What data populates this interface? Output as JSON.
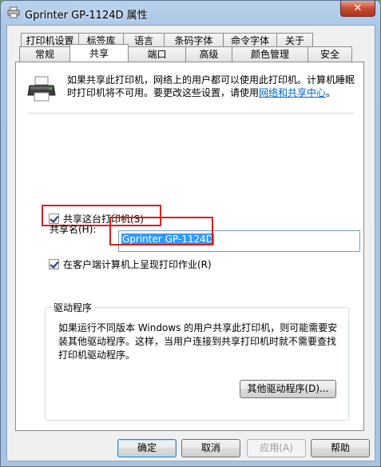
{
  "window": {
    "title": "Gprinter  GP-1124D 属性",
    "close_label": "✕"
  },
  "tabs_back": [
    "打印机设置",
    "标签库",
    "语言",
    "条码字体",
    "命令字体",
    "关于"
  ],
  "tabs_front": [
    "常规",
    "共享",
    "端口",
    "高级",
    "颜色管理",
    "安全"
  ],
  "active_tab": "共享",
  "panel": {
    "info_text": "如果共享此打印机，网络上的用户都可以使用此打印机。计算机睡眠时打印机将不可用。要更改这些设置，请使用",
    "info_link": "网络和共享中心",
    "info_end": "。",
    "share_checkbox_label": "共享这台打印机(S)",
    "share_name_label": "共享名(H):",
    "share_name_value": "Gprinter  GP-1124D",
    "render_jobs_label": "在客户端计算机上呈现打印作业(R)",
    "drivers_title": "驱动程序",
    "drivers_text": "如果运行不同版本 Windows 的用户共享此打印机，则可能需要安装其他驱动程序。这样，当用户连接到共享打印机时就不需要查找打印机驱动程序。",
    "other_drivers_button": "其他驱动程序(D)..."
  },
  "buttons": {
    "ok": "确定",
    "cancel": "取消",
    "apply": "应用(A)",
    "help": "帮助"
  }
}
